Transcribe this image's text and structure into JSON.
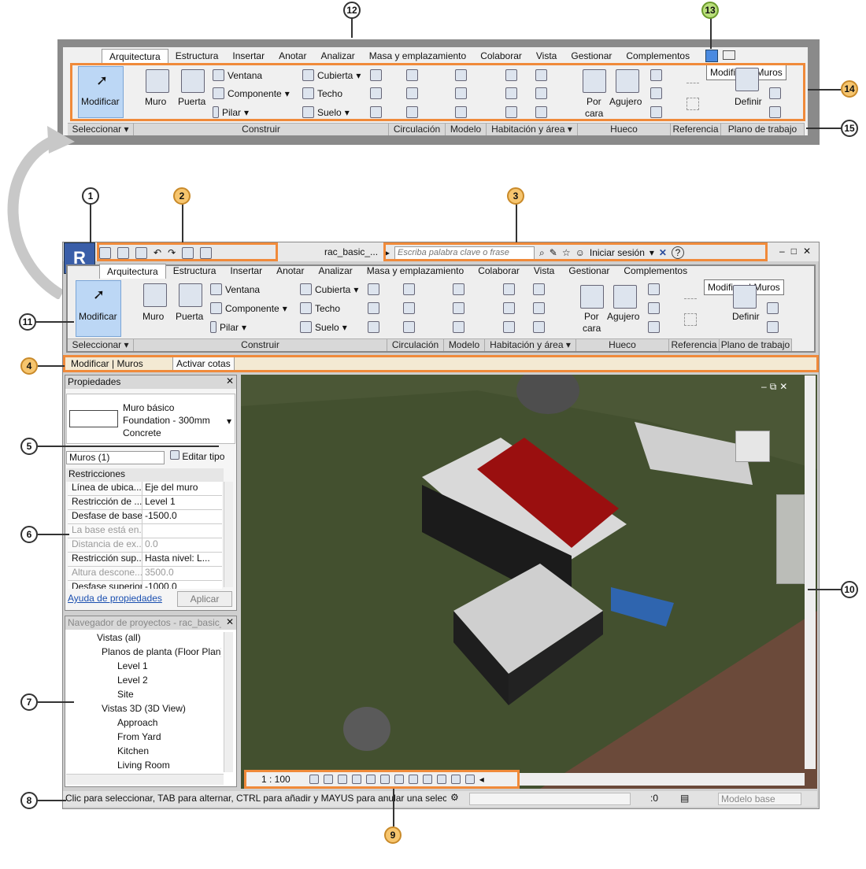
{
  "callouts": [
    "1",
    "2",
    "3",
    "4",
    "5",
    "6",
    "7",
    "8",
    "9",
    "10",
    "11",
    "12",
    "13",
    "14",
    "15"
  ],
  "ribbon_tabs": [
    "Arquitectura",
    "Estructura",
    "Insertar",
    "Anotar",
    "Analizar",
    "Masa y emplazamiento",
    "Colaborar",
    "Vista",
    "Gestionar",
    "Complementos"
  ],
  "ribbon": {
    "modificar": "Modificar",
    "muro": "Muro",
    "puerta": "Puerta",
    "ventana": "Ventana",
    "componente": "Componente",
    "pilar": "Pilar",
    "cubierta": "Cubierta",
    "techo": "Techo",
    "suelo": "Suelo",
    "por_cara_1": "Por",
    "por_cara_2": "cara",
    "agujero": "Agujero",
    "definir": "Definir",
    "tooltip": "Modificar | Muros"
  },
  "panels": [
    "Seleccionar ▾",
    "Construir",
    "Circulación",
    "Modelo",
    "Habitación y área ▾",
    "Hueco",
    "Referencia",
    "Plano de trabajo"
  ],
  "titlebar": {
    "filename": "rac_basic_...",
    "search_placeholder": "Escriba palabra clave o frase",
    "signin": "Iniciar sesión",
    "help": "?"
  },
  "options_bar": {
    "context": "Modificar | Muros",
    "activar_cotas": "Activar cotas"
  },
  "properties": {
    "title": "Propiedades",
    "type_line1": "Muro básico",
    "type_line2": "Foundation - 300mm",
    "type_line3": "Concrete",
    "selector": "Muros (1)",
    "edit_type": "Editar tipo",
    "group": "Restricciones",
    "rows": [
      {
        "k": "Línea de ubica...",
        "v": "Eje del muro",
        "dis": false
      },
      {
        "k": "Restricción de ...",
        "v": "Level 1",
        "dis": false
      },
      {
        "k": "Desfase de base",
        "v": "-1500.0",
        "dis": false
      },
      {
        "k": "La base está en...",
        "v": "",
        "dis": true
      },
      {
        "k": "Distancia de ex...",
        "v": "0.0",
        "dis": true
      },
      {
        "k": "Restricción sup...",
        "v": "Hasta nivel: L...",
        "dis": false
      },
      {
        "k": "Altura descone...",
        "v": "3500.0",
        "dis": true
      },
      {
        "k": "Desfase superior",
        "v": "-1000.0",
        "dis": false
      }
    ],
    "help_link": "Ayuda de propiedades",
    "apply": "Aplicar"
  },
  "browser": {
    "title": "Navegador de proyectos - rac_basic_...",
    "items": [
      "Vistas (all)",
      "Planos de planta (Floor Plan)",
      "Level 1",
      "Level 2",
      "Site",
      "Vistas 3D (3D View)",
      "Approach",
      "From Yard",
      "Kitchen",
      "Living Room"
    ]
  },
  "view_bar": {
    "scale": "1 : 100"
  },
  "status_bar": {
    "message": "Clic para seleccionar, TAB para alternar, CTRL para añadir y MAYUS para anular una selecció",
    "count": ":0",
    "model": "Modelo base"
  },
  "colors": {
    "accent": "#f08a3a",
    "roof": "#a01010",
    "terrain": "#3d4a2a",
    "selected": "#2a6ad0"
  }
}
